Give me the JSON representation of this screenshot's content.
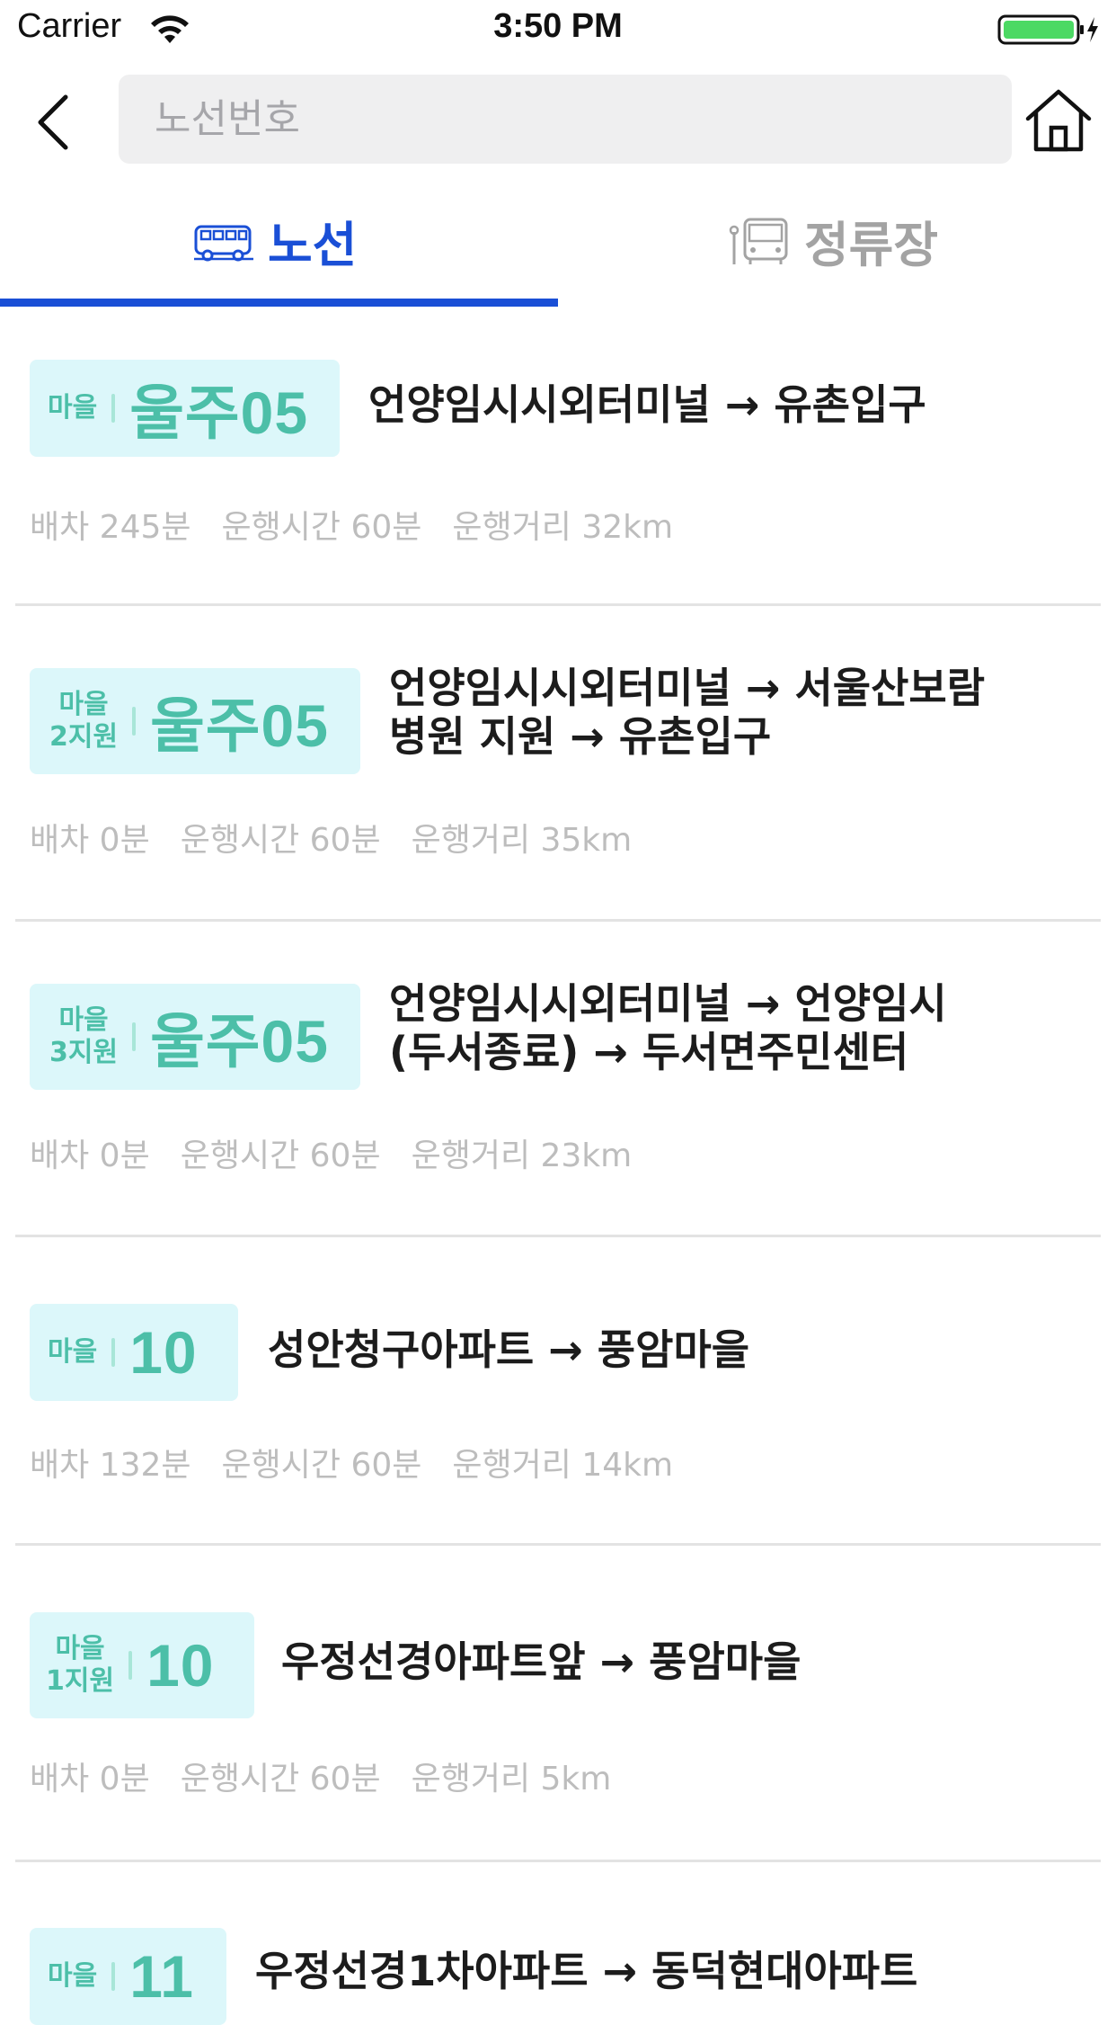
{
  "status_bar": {
    "carrier": "Carrier",
    "time": "3:50 PM"
  },
  "header": {
    "back_icon": "chevron-left-icon",
    "search_placeholder": "노선번호",
    "search_value": "",
    "home_icon": "home-icon"
  },
  "tabs": [
    {
      "label": "노선",
      "icon": "bus-icon",
      "active": true
    },
    {
      "label": "정류장",
      "icon": "bus-stop-icon",
      "active": false
    }
  ],
  "colors": {
    "accent": "#1a4fd6",
    "badge_bg": "#dcf7fa",
    "badge_text": "#4cbfa8",
    "meta_text": "#bdbdbd",
    "battery": "#4cd964"
  },
  "routes": [
    {
      "type": "마을",
      "number": "울주05",
      "name_lines": [
        "언양임시시외터미널 → 유촌입구"
      ],
      "interval": "배차 245분",
      "duration": "운행시간 60분",
      "distance": "운행거리 32km"
    },
    {
      "type": "마을\n2지원",
      "number": "울주05",
      "name_lines": [
        "언양임시시외터미널 → 서울산보람",
        "병원 지원 → 유촌입구"
      ],
      "interval": "배차 0분",
      "duration": "운행시간 60분",
      "distance": "운행거리 35km"
    },
    {
      "type": "마을\n3지원",
      "number": "울주05",
      "name_lines": [
        "언양임시시외터미널 → 언양임시",
        "(두서종료) → 두서면주민센터"
      ],
      "interval": "배차 0분",
      "duration": "운행시간 60분",
      "distance": "운행거리 23km"
    },
    {
      "type": "마을",
      "number": "10",
      "name_lines": [
        "성안청구아파트 → 풍암마을"
      ],
      "interval": "배차 132분",
      "duration": "운행시간 60분",
      "distance": "운행거리 14km"
    },
    {
      "type": "마을\n1지원",
      "number": "10",
      "name_lines": [
        "우정선경아파트앞 → 풍암마을"
      ],
      "interval": "배차 0분",
      "duration": "운행시간 60분",
      "distance": "운행거리 5km"
    },
    {
      "type": "마을",
      "number": "11",
      "name_lines": [
        "우정선경1차아파트 → 동덕현대아파트"
      ],
      "interval": "",
      "duration": "",
      "distance": ""
    }
  ]
}
